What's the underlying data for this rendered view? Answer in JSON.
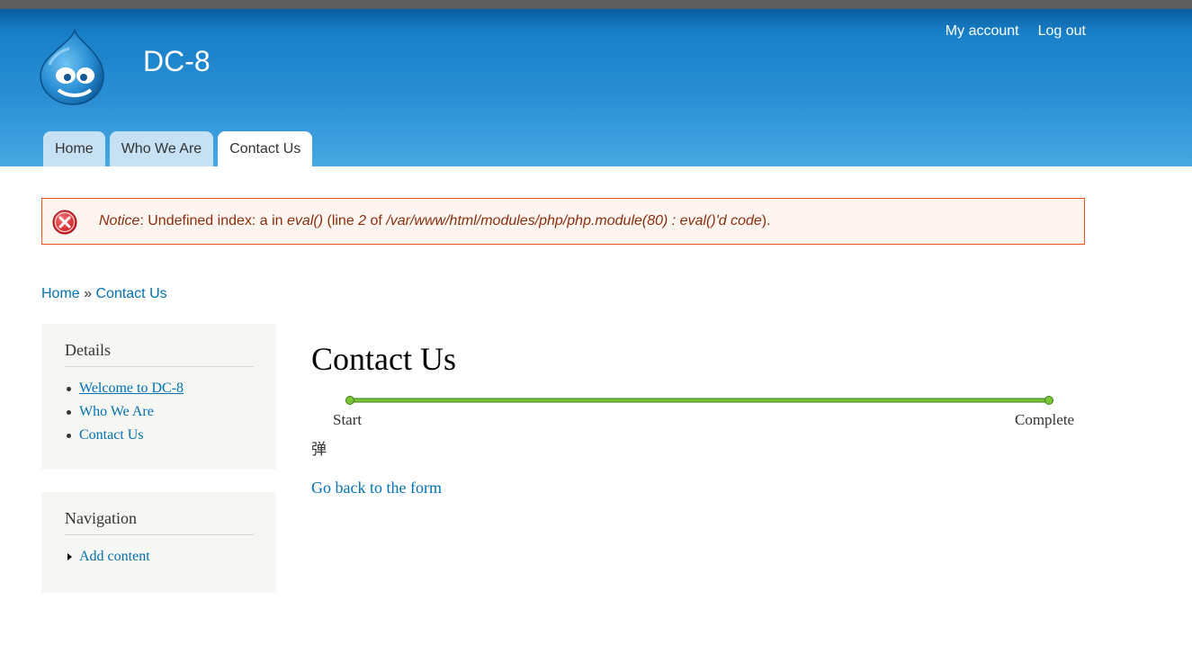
{
  "site": {
    "name": "DC-8",
    "logo_icon": "drupal-drop-logo-icon"
  },
  "secondary_menu": {
    "my_account": "My account",
    "log_out": "Log out"
  },
  "tabs": [
    {
      "label": "Home",
      "active": false
    },
    {
      "label": "Who We Are",
      "active": false
    },
    {
      "label": "Contact Us",
      "active": true
    }
  ],
  "message": {
    "type": "error",
    "icon": "error-x-icon",
    "notice": "Notice",
    "text1": ": Undefined index: a in ",
    "func": "eval()",
    "text2": " (line ",
    "line": "2",
    "text3": " of ",
    "file": "/var/www/html/modules/php/php.module(80) : eval()'d code",
    "text4": ")."
  },
  "breadcrumb": {
    "home": "Home",
    "separator": " » ",
    "current": "Contact Us"
  },
  "sidebar": {
    "details": {
      "title": "Details",
      "items": [
        "Welcome to DC-8",
        "Who We Are",
        "Contact Us"
      ]
    },
    "navigation": {
      "title": "Navigation",
      "items": [
        "Add content"
      ]
    }
  },
  "main": {
    "title": "Contact Us",
    "progress": {
      "start_label": "Start",
      "complete_label": "Complete",
      "percent": 100
    },
    "result_text": "弹",
    "back_link": "Go back to the form"
  },
  "colors": {
    "header_blue": "#1880c9",
    "link": "#0071b3",
    "error_border": "#ed541d",
    "error_bg": "#fef5f1",
    "progress_green": "#7ac536"
  }
}
